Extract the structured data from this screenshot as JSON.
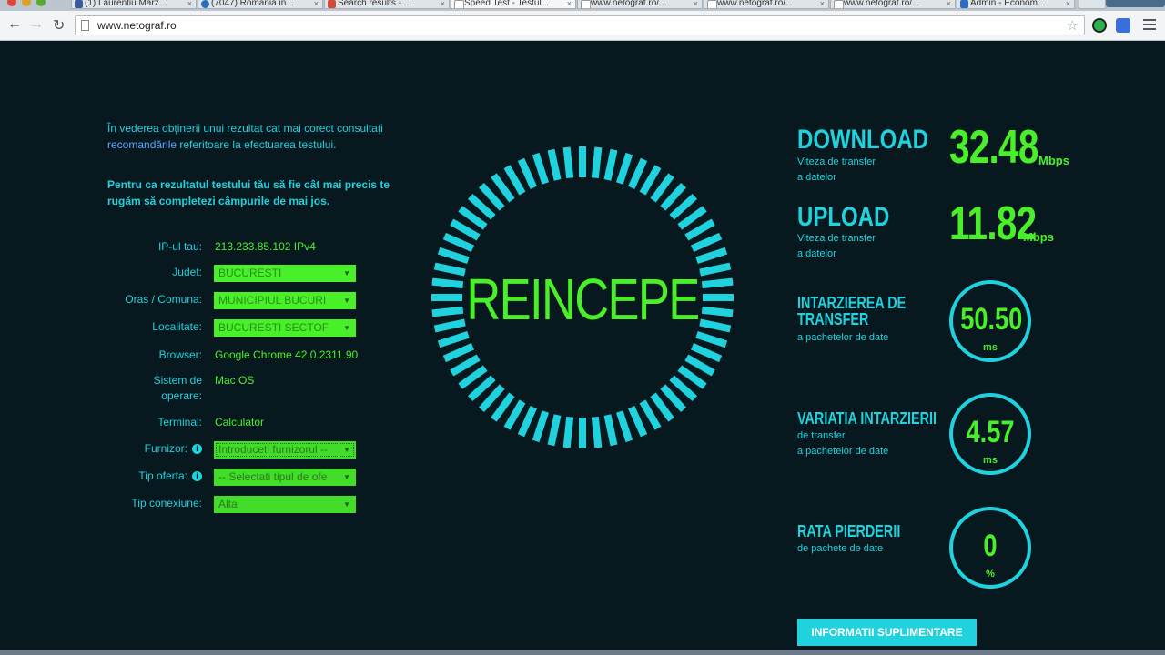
{
  "browser": {
    "tabs": [
      {
        "title": "(1) Laurentiu Marz...",
        "color": "#3b5998"
      },
      {
        "title": "(7047) Romania in...",
        "color": "#2a6fb5"
      },
      {
        "title": "Search results - ...",
        "color": "#d24a3a"
      },
      {
        "title": "Speed Test - Testul...",
        "color": "#ccd"
      },
      {
        "title": "www.netograf.ro/...",
        "color": "#ccd"
      },
      {
        "title": "www.netograf.ro/...",
        "color": "#ccd"
      },
      {
        "title": "www.netograf.ro/...",
        "color": "#ccd"
      },
      {
        "title": "Admin - Econom...",
        "color": "#2d6cc0"
      }
    ],
    "url": "www.netograf.ro"
  },
  "intro": {
    "line1_pre": "În vederea obținerii unui rezultat cat mai corect consultați ",
    "link": "recomandările",
    "line1_post": " referitoare la efectuarea testului.",
    "line2": "Pentru ca rezultatul testului tău să fie cât mai precis te rugăm să completezi câmpurile de mai jos."
  },
  "form": {
    "ip_label": "IP-ul tau:",
    "ip_value": "213.233.85.102 IPv4",
    "judet_label": "Judet:",
    "judet_value": "BUCURESTI",
    "oras_label": "Oras / Comuna:",
    "oras_value": "MUNICIPIUL BUCURI",
    "localitate_label": "Localitate:",
    "localitate_value": "BUCURESTI SECTOF",
    "browser_label": "Browser:",
    "browser_value": "Google Chrome 42.0.2311.90",
    "sistem_label_1": "Sistem de",
    "sistem_label_2": "operare:",
    "sistem_value": "Mac OS",
    "terminal_label": "Terminal:",
    "terminal_value": "Calculator",
    "furnizor_label": "Furnizor:",
    "furnizor_value": "Introduceti furnizorul --",
    "oferta_label": "Tip oferta:",
    "oferta_value": "-- Selectati tipul de ofe",
    "conexiune_label": "Tip conexiune:",
    "conexiune_value": "Alta"
  },
  "gauge": {
    "label": "REINCEPE",
    "accent": "#1fd2dd",
    "text_color": "#49f02a"
  },
  "stats": {
    "download": {
      "title": "DOWNLOAD",
      "sub1": "Viteza de transfer",
      "sub2": "a datelor",
      "value": "32.48",
      "unit": "Mbps"
    },
    "upload": {
      "title": "UPLOAD",
      "sub1": "Viteza de transfer",
      "sub2": "a datelor",
      "value": "11.82",
      "unit": "Mbps"
    },
    "latency": {
      "title1": "INTARZIEREA DE",
      "title2": "TRANSFER",
      "sub": "a pachetelor de date",
      "value": "50.50",
      "unit": "ms"
    },
    "jitter": {
      "title": "VARIATIA INTARZIERII",
      "sub1": "de transfer",
      "sub2": "a pachetelor de date",
      "value": "4.57",
      "unit": "ms"
    },
    "loss": {
      "title": "RATA PIERDERII",
      "sub": "de pachete de date",
      "value": "0",
      "unit": "%"
    }
  },
  "more_button": "INFORMATII SUPLIMENTARE"
}
